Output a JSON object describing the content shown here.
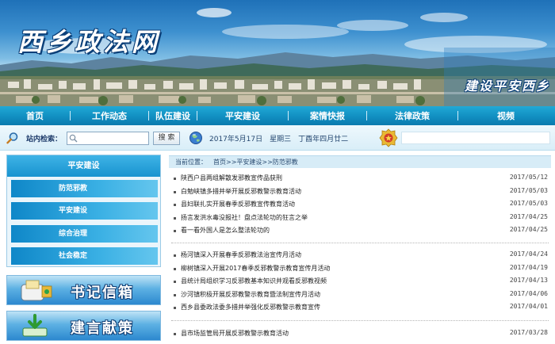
{
  "header": {
    "site_title": "西乡政法网",
    "slogan": "建设平安西乡"
  },
  "nav": {
    "items": [
      "首页",
      "工作动态",
      "队伍建设",
      "平安建设",
      "案情快报",
      "法律政策",
      "视频"
    ]
  },
  "search": {
    "label": "站内检索：",
    "placeholder": "",
    "button_label": "搜 索",
    "date_text": "2017年5月17日　星期三　丁酉年四月廿二"
  },
  "sidebar": {
    "title": "平安建设",
    "items": [
      "防范邪教",
      "平安建设",
      "综合治理",
      "社会稳定"
    ],
    "promos": [
      "书记信箱",
      "建言献策"
    ]
  },
  "breadcrumb": {
    "label": "当前位置：",
    "path": "首页>>平安建设>>防范邪教"
  },
  "news_groups": [
    [
      {
        "title": "陕西户县两组解散发邪教宣传品获刑",
        "date": "2017/05/12"
      },
      {
        "title": "白勉峡镇多措并举开展反邪教警示教育活动",
        "date": "2017/05/03"
      },
      {
        "title": "县妇联扎实开展春季反邪教宣传教育活动",
        "date": "2017/05/03"
      },
      {
        "title": "扬言发洪水毒没报社！盘点法轮功的狂言之举",
        "date": "2017/04/25"
      },
      {
        "title": "看一看外国人是怎么整法轮功的",
        "date": "2017/04/25"
      }
    ],
    [
      {
        "title": "杨河镇深入开展春季反邪教法治宣传月活动",
        "date": "2017/04/24"
      },
      {
        "title": "柳树镇深入开展2017春季反邪教警示教育宣传月活动",
        "date": "2017/04/19"
      },
      {
        "title": "县统计局组织学习反邪教基本知识并观看反邪教视频",
        "date": "2017/04/13"
      },
      {
        "title": "沙河镇积极开展反邪教警示教育暨法制宣传月活动",
        "date": "2017/04/06"
      },
      {
        "title": "西乡县委政法委多措并举强化反邪教警示教育宣传",
        "date": "2017/04/01"
      }
    ],
    [
      {
        "title": "县市场监管局开展反邪教警示教育活动",
        "date": "2017/03/28"
      }
    ]
  ]
}
